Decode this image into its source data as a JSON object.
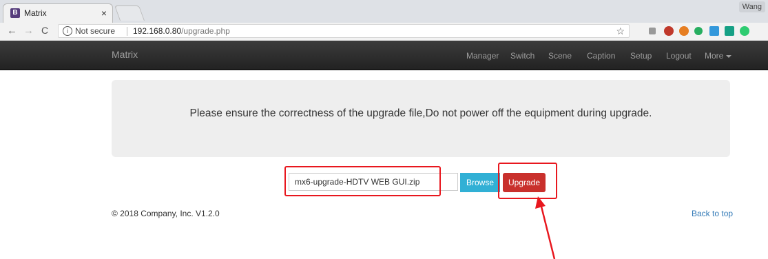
{
  "browser": {
    "tab_title": "Matrix",
    "tab_favicon": "B",
    "tab_close": "×",
    "profile_name": "Wang",
    "back_glyph": "←",
    "forward_glyph": "→",
    "reload_glyph": "C",
    "info_glyph": "i",
    "security_label": "Not secure",
    "url_host": "192.168.0.80",
    "url_path": "/upgrade.php",
    "bookmark_glyph": "☆",
    "icons": [
      "bookmark-star-icon",
      "extension-icon",
      "extension-icon",
      "extension-icon",
      "extension-icon",
      "extension-icon",
      "extension-icon",
      "extension-icon"
    ]
  },
  "navbar": {
    "brand": "Matrix",
    "items": [
      "Manager",
      "Switch",
      "Scene",
      "Caption",
      "Setup",
      "Logout",
      "More"
    ]
  },
  "main": {
    "notice": "Please ensure the correctness of the upgrade file,Do not power off the equipment during upgrade.",
    "file_name": "mx6-upgrade-HDTV WEB GUI.zip",
    "browse_label": "Browse",
    "upgrade_label": "Upgrade"
  },
  "footer": {
    "copyright": "© 2018 Company, Inc. V1.2.0",
    "back_to_top": "Back to top"
  },
  "colors": {
    "annotation": "#e8171e",
    "browse": "#31b0d5",
    "upgrade": "#c9302c",
    "navbar": "#222222",
    "link": "#337ab7"
  }
}
